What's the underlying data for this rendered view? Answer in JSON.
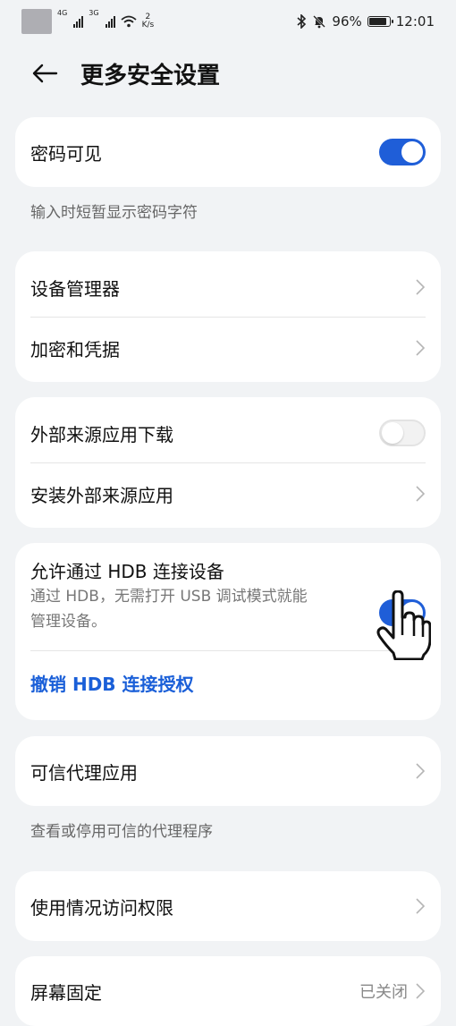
{
  "status_bar": {
    "net1": "4G",
    "net2": "3G",
    "speed_value": "2",
    "speed_unit": "K/s",
    "battery": "96%",
    "battery_level": 0.96,
    "time": "12:01"
  },
  "header": {
    "title": "更多安全设置"
  },
  "password_visible": {
    "label": "密码可见",
    "enabled": true,
    "description": "输入时短暂显示密码字符"
  },
  "device_group": {
    "device_manager": "设备管理器",
    "encryption": "加密和凭据"
  },
  "external_group": {
    "external_download": "外部来源应用下载",
    "external_download_enabled": false,
    "install_external": "安装外部来源应用"
  },
  "hdb": {
    "label": "允许通过 HDB 连接设备",
    "sub_line1": "通过 HDB，无需打开 USB 调试模式就能",
    "sub_line2": "管理设备。",
    "enabled": true,
    "revoke": "撤销 HDB 连接授权"
  },
  "trust_agents": {
    "label": "可信代理应用",
    "description": "查看或停用可信的代理程序"
  },
  "usage_access": {
    "label": "使用情况访问权限"
  },
  "screen_pinning": {
    "label": "屏幕固定",
    "value": "已关闭"
  },
  "colors": {
    "accent": "#1f5ed8",
    "link": "#1a5fd8",
    "background": "#f1f3f5"
  }
}
